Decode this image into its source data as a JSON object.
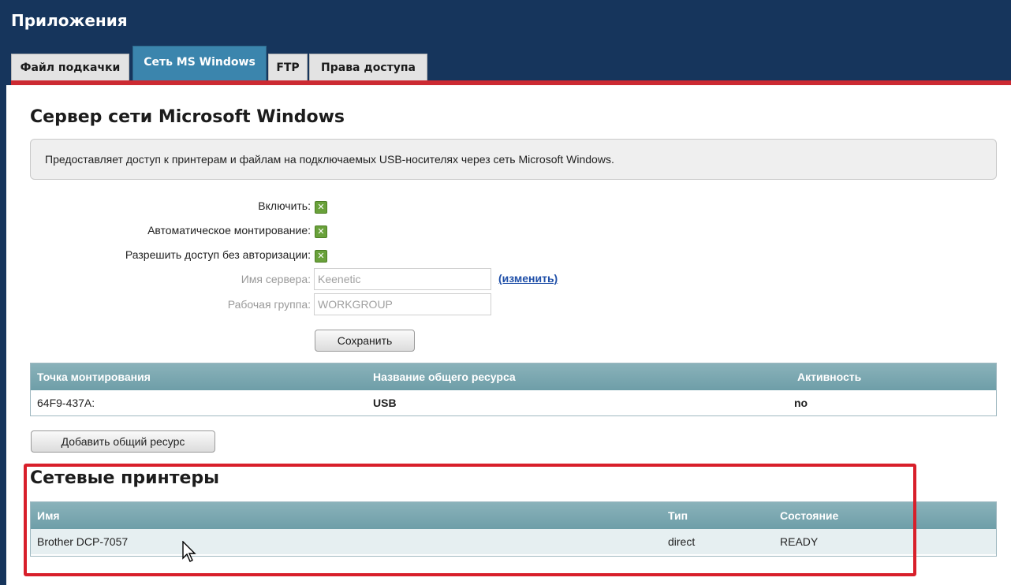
{
  "app": {
    "title": "Приложения"
  },
  "tabs": [
    {
      "label": "Файл подкачки",
      "active": false
    },
    {
      "label": "Сеть MS Windows",
      "active": true
    },
    {
      "label": "FTP",
      "active": false
    },
    {
      "label": "Права доступа",
      "active": false
    }
  ],
  "section": {
    "title": "Сервер сети Microsoft Windows",
    "description": "Предоставляет доступ к принтерам и файлам на подключаемых USB-носителях через сеть Microsoft Windows."
  },
  "form": {
    "enable": {
      "label": "Включить:",
      "checked": true
    },
    "automount": {
      "label": "Автоматическое монтирование:",
      "checked": true
    },
    "anonymous": {
      "label": "Разрешить доступ без авторизации:",
      "checked": true
    },
    "server_name": {
      "label": "Имя сервера:",
      "value": "Keenetic",
      "change_link": "(изменить)"
    },
    "workgroup": {
      "label": "Рабочая группа:",
      "value": "WORKGROUP"
    },
    "save_label": "Сохранить"
  },
  "shares": {
    "columns": [
      "Точка монтирования",
      "Название общего ресурса",
      "Активность"
    ],
    "rows": [
      {
        "mount": "64F9-437A:",
        "name": "USB",
        "active": "no"
      }
    ],
    "add_label": "Добавить общий ресурс"
  },
  "printers": {
    "title": "Сетевые принтеры",
    "columns": [
      "Имя",
      "Тип",
      "Состояние"
    ],
    "rows": [
      {
        "name": "Brother DCP-7057",
        "type": "direct",
        "state": "READY"
      }
    ]
  },
  "colors": {
    "header_bg": "#16355c",
    "active_tab": "#3b85ad",
    "accent_red": "#cc2a32",
    "table_header": "#7aa7b0",
    "checkbox_green": "#69a13a"
  }
}
